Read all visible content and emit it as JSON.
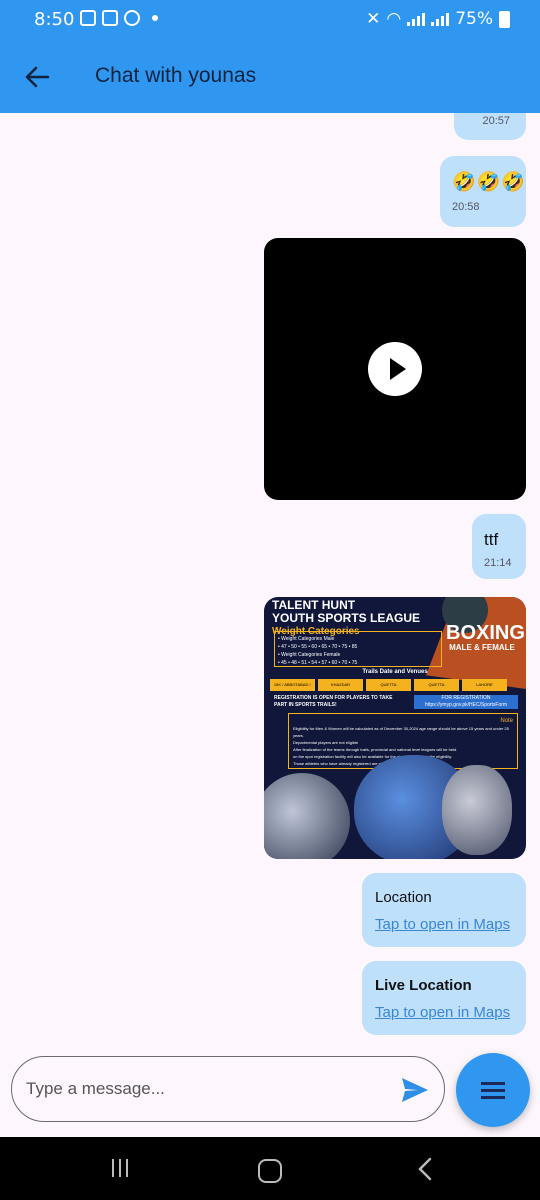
{
  "status_bar": {
    "time": "8:50",
    "battery": "75%"
  },
  "app_bar": {
    "title": "Chat with younas"
  },
  "messages": [
    {
      "type": "text",
      "time": "20:57"
    },
    {
      "type": "text",
      "content": "🤣🤣🤣",
      "time": "20:58"
    },
    {
      "type": "video"
    },
    {
      "type": "text",
      "content": "ttf",
      "time": "21:14"
    },
    {
      "type": "image",
      "poster": {
        "title_line1": "TALENT HUNT",
        "title_line2": "YOUTH SPORTS LEAGUE",
        "subtitle": "Weight Categories",
        "male_label": "• Weight Categories Male",
        "male_values": "• 47   • 50   • 55   • 60   • 65   • 70   • 75   • 85",
        "female_label": "• Weight Categories Female",
        "female_values": "• 45   • 48   • 51   • 54   • 57   • 60   • 70   • 75",
        "sport": "BOXING",
        "sport_sub": "MALE & FEMALE",
        "trails": "Trails Date and Venues",
        "venues": [
          "DIK / ABBOTABAD / TURBAT",
          "KHAZDAR",
          "QUETTA",
          "QUETTA",
          "LAHORE"
        ],
        "registration": "REGISTRATION IS OPEN FOR PLAYERS TO TAKE PART IN SPORTS TRAILS!",
        "reg_link_label": "FOR REGISTRATION",
        "reg_link": "https://ymyp.gov.pk/HEC/SportsForm",
        "note_title": "Note",
        "notes": [
          "Eligibility for Men & Women will be calculated as of December 30,2024 age range should be above 15 years and under 25 years.",
          "Departmental players are not eligible",
          "After finalization of the teams through trails, provincial and national level leagues will be held.",
          "on the spot registration facility will also be available for the players who meet the eligibility.",
          "Those athletes who have already registered are eligible for trials. (Men & Women)"
        ]
      }
    },
    {
      "type": "location",
      "title": "Location",
      "link": "Tap to open in Maps"
    },
    {
      "type": "location",
      "title": "Live Location",
      "link": "Tap to open in Maps"
    }
  ],
  "composer": {
    "placeholder": "Type a message...",
    "value": ""
  },
  "icons": {
    "back": "arrow-left-icon",
    "play": "play-icon",
    "send": "send-icon",
    "fab": "menu-icon",
    "nav": [
      "recent-apps-icon",
      "home-icon",
      "back-nav-icon"
    ]
  },
  "colors": {
    "app_bar": "#2f97ef",
    "bubble": "#bfe0fb",
    "link": "#3a86d4",
    "background": "#fdf7fd"
  }
}
